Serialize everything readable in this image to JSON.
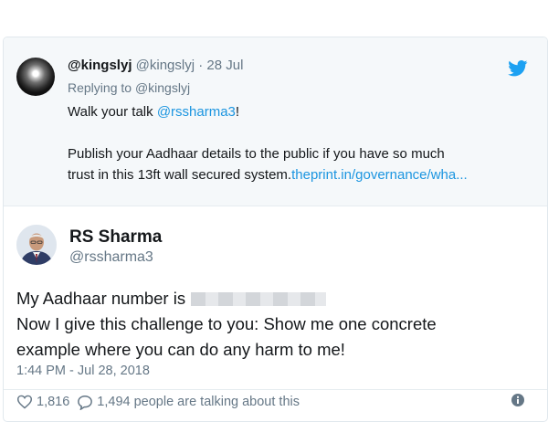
{
  "parent_tweet": {
    "display_name": "@kingslyj",
    "handle": "@kingslyj",
    "date_sep": "·",
    "date": "28 Jul",
    "replying_prefix": "Replying to",
    "replying_to": "@kingslyj",
    "line1_prefix": "Walk your talk",
    "line1_mention": "@rssharma3",
    "line1_suffix": "!",
    "line2": "Publish your Aadhaar details to the public if you have so much",
    "line3_prefix": "trust in this 13ft wall secured system.",
    "line3_link": "theprint.in/governance/wha...",
    "twitter_icon": "twitter-bird-icon"
  },
  "main_tweet": {
    "display_name": "RS Sharma",
    "handle": "@rssharma3",
    "line1": "My Aadhaar number is",
    "line2": "Now I give this challenge to you: Show me one concrete",
    "line3": "example where you can do any harm to me!",
    "timestamp": "1:44 PM - Jul 28, 2018",
    "likes": "1,816",
    "talking": "1,494 people are talking about this"
  },
  "colors": {
    "link": "#1b95e0",
    "secondary_text": "#657786",
    "parent_background": "#f5f8fa"
  }
}
